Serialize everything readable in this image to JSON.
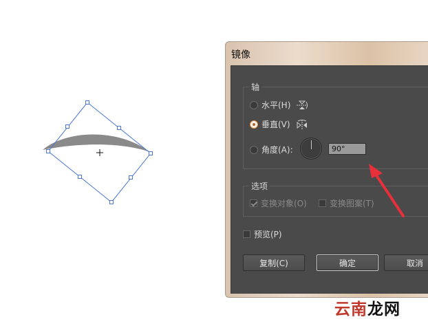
{
  "dialog": {
    "title": "镜像",
    "axis_group": {
      "label": "轴",
      "horizontal": "水平(H)",
      "vertical": "垂直(V)",
      "angle": "角度(A):",
      "angle_value": "90°",
      "selected": "vertical"
    },
    "options_group": {
      "label": "选项",
      "transform_objects": "变换对象(O)",
      "transform_objects_checked": true,
      "transform_patterns": "变换图案(T)",
      "transform_patterns_checked": false
    },
    "preview": "预览(P)",
    "preview_checked": false,
    "buttons": {
      "copy": "复制(C)",
      "ok": "确定",
      "cancel": "取消"
    }
  },
  "watermark": {
    "part1": "云南",
    "part2": "龙网"
  },
  "colors": {
    "selection": "#4a78d0",
    "shape_fill": "#8a8a8a",
    "arrow": "#e8303a",
    "dialog_bg": "#4a4a4a"
  }
}
